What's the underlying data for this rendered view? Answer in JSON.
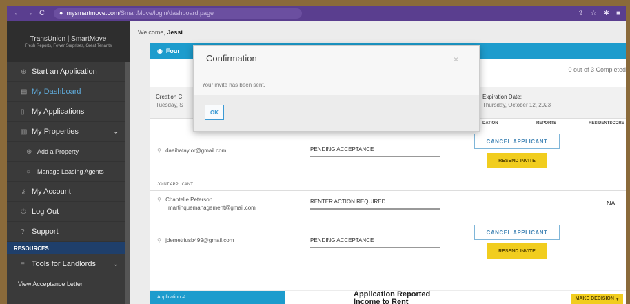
{
  "browser": {
    "url_host": "mysmartmove.com",
    "url_path": "/SmartMove/login/dashboard.page",
    "back": "←",
    "forward": "→",
    "reload": "C"
  },
  "sidebar": {
    "brand": "TransUnion | SmartMove",
    "brand_tag": "Fresh Reports, Fewer Surprises, Great Tenants",
    "items": [
      {
        "label": "Start an Application"
      },
      {
        "label": "My Dashboard"
      },
      {
        "label": "My Applications"
      },
      {
        "label": "My Properties"
      },
      {
        "label": "Add a Property"
      },
      {
        "label": "Manage Leasing Agents"
      },
      {
        "label": "My Account"
      },
      {
        "label": "Log Out"
      },
      {
        "label": "Support"
      }
    ],
    "resources_header": "RESOURCES",
    "tools": "Tools for Landlords",
    "view_letter": "View Acceptance Letter"
  },
  "main": {
    "welcome_prefix": "Welcome,",
    "welcome_name": "Jessi",
    "card_header": "Four",
    "completed": "0 out of 3 Completed",
    "creation_label": "Creation C",
    "creation_value": "Tuesday, S",
    "expiration_label": "Expiration Date:",
    "expiration_value": "Thursday, October 12, 2023",
    "col_dation": "DATION",
    "col_reports": "REPORTS",
    "col_residentscore": "RESIDENTSCORE",
    "applicant1": {
      "email": "daeihataylor@gmail.com",
      "status": "PENDING ACCEPTANCE"
    },
    "joint_label": "JOINT APPLICANT",
    "applicant2": {
      "name": "Chantelle Peterson",
      "email": "martinquemanagement@gmail.com",
      "status": "RENTER ACTION REQUIRED",
      "score": "NA"
    },
    "applicant3": {
      "email": "jdemetriusb499@gmail.com",
      "status": "PENDING ACCEPTANCE"
    },
    "cancel_label": "CANCEL APPLICANT",
    "resend_label": "RESEND INVITE",
    "app_number_label": "Application #",
    "app_reported_title": "Application Reported",
    "app_reported_sub": "Income to Rent",
    "make_decision": "MAKE DECISION"
  },
  "modal": {
    "title": "Confirmation",
    "close": "×",
    "message": "Your invite has been sent.",
    "ok": "OK"
  }
}
